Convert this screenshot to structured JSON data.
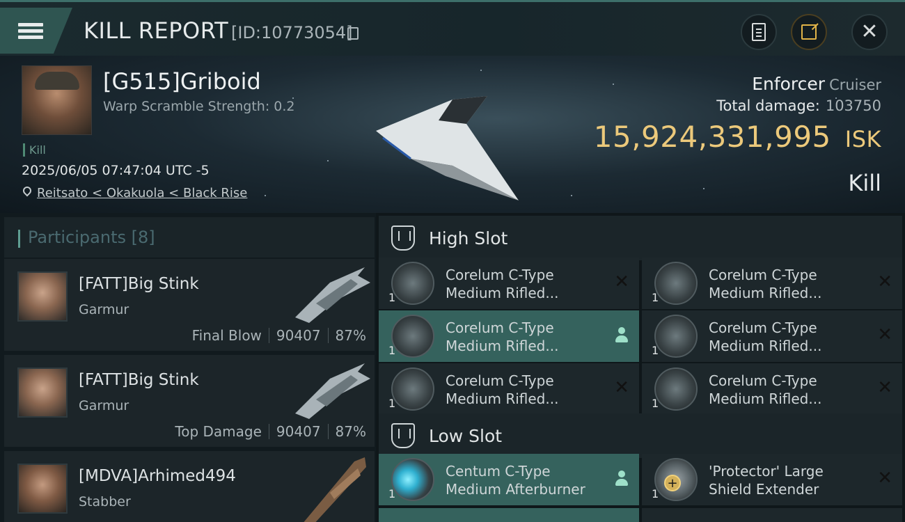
{
  "header": {
    "title": "KILL REPORT",
    "report_id": "[ID:10773054]"
  },
  "victim": {
    "name": "[G515]Griboid",
    "warp_scramble": "Warp Scramble Strength: 0.2",
    "tag": "Kill",
    "datetime": "2025/06/05 07:47:04 UTC -5",
    "location": "Reitsato < Okakuola < Black Rise",
    "ship": "Enforcer",
    "ship_class": "Cruiser",
    "total_damage_label": "Total damage:",
    "total_damage": "103750",
    "isk_value": "15,924,331,995",
    "isk_unit": "ISK",
    "result": "Kill"
  },
  "participants": {
    "label": "Participants",
    "count": "[8]",
    "items": [
      {
        "name": "[FATT]Big Stink",
        "ship": "Garmur",
        "role": "Final Blow",
        "damage": "90407",
        "percent": "87%"
      },
      {
        "name": "[FATT]Big Stink",
        "ship": "Garmur",
        "role": "Top Damage",
        "damage": "90407",
        "percent": "87%"
      },
      {
        "name": "[MDVA]Arhimed494",
        "ship": "Stabber"
      }
    ]
  },
  "fitting": {
    "high_slot_label": "High Slot",
    "low_slot_label": "Low Slot",
    "high_modules": [
      {
        "qty": "1",
        "name1": "Corelum C-Type",
        "name2": "Medium Rifled...",
        "state": "destroyed"
      },
      {
        "qty": "1",
        "name1": "Corelum C-Type",
        "name2": "Medium Rifled...",
        "state": "destroyed"
      },
      {
        "qty": "1",
        "name1": "Corelum C-Type",
        "name2": "Medium Rifled...",
        "state": "dropped"
      },
      {
        "qty": "1",
        "name1": "Corelum C-Type",
        "name2": "Medium Rifled...",
        "state": "destroyed"
      },
      {
        "qty": "1",
        "name1": "Corelum C-Type",
        "name2": "Medium Rifled...",
        "state": "destroyed"
      },
      {
        "qty": "1",
        "name1": "Corelum C-Type",
        "name2": "Medium Rifled...",
        "state": "destroyed"
      }
    ],
    "low_modules": [
      {
        "qty": "1",
        "name1": "Centum C-Type",
        "name2": "Medium Afterburner",
        "state": "dropped"
      },
      {
        "qty": "1",
        "name1": "'Protector' Large",
        "name2": "Shield Extender",
        "state": "destroyed"
      }
    ]
  },
  "icons": [
    "menu-icon",
    "copy-icon",
    "clipboard-icon",
    "share-icon",
    "close-icon",
    "location-pin-icon",
    "slot-icon",
    "person-icon",
    "x-icon"
  ],
  "colors": {
    "accent_teal": "#35625d",
    "isk_gold": "#ecc97b"
  }
}
